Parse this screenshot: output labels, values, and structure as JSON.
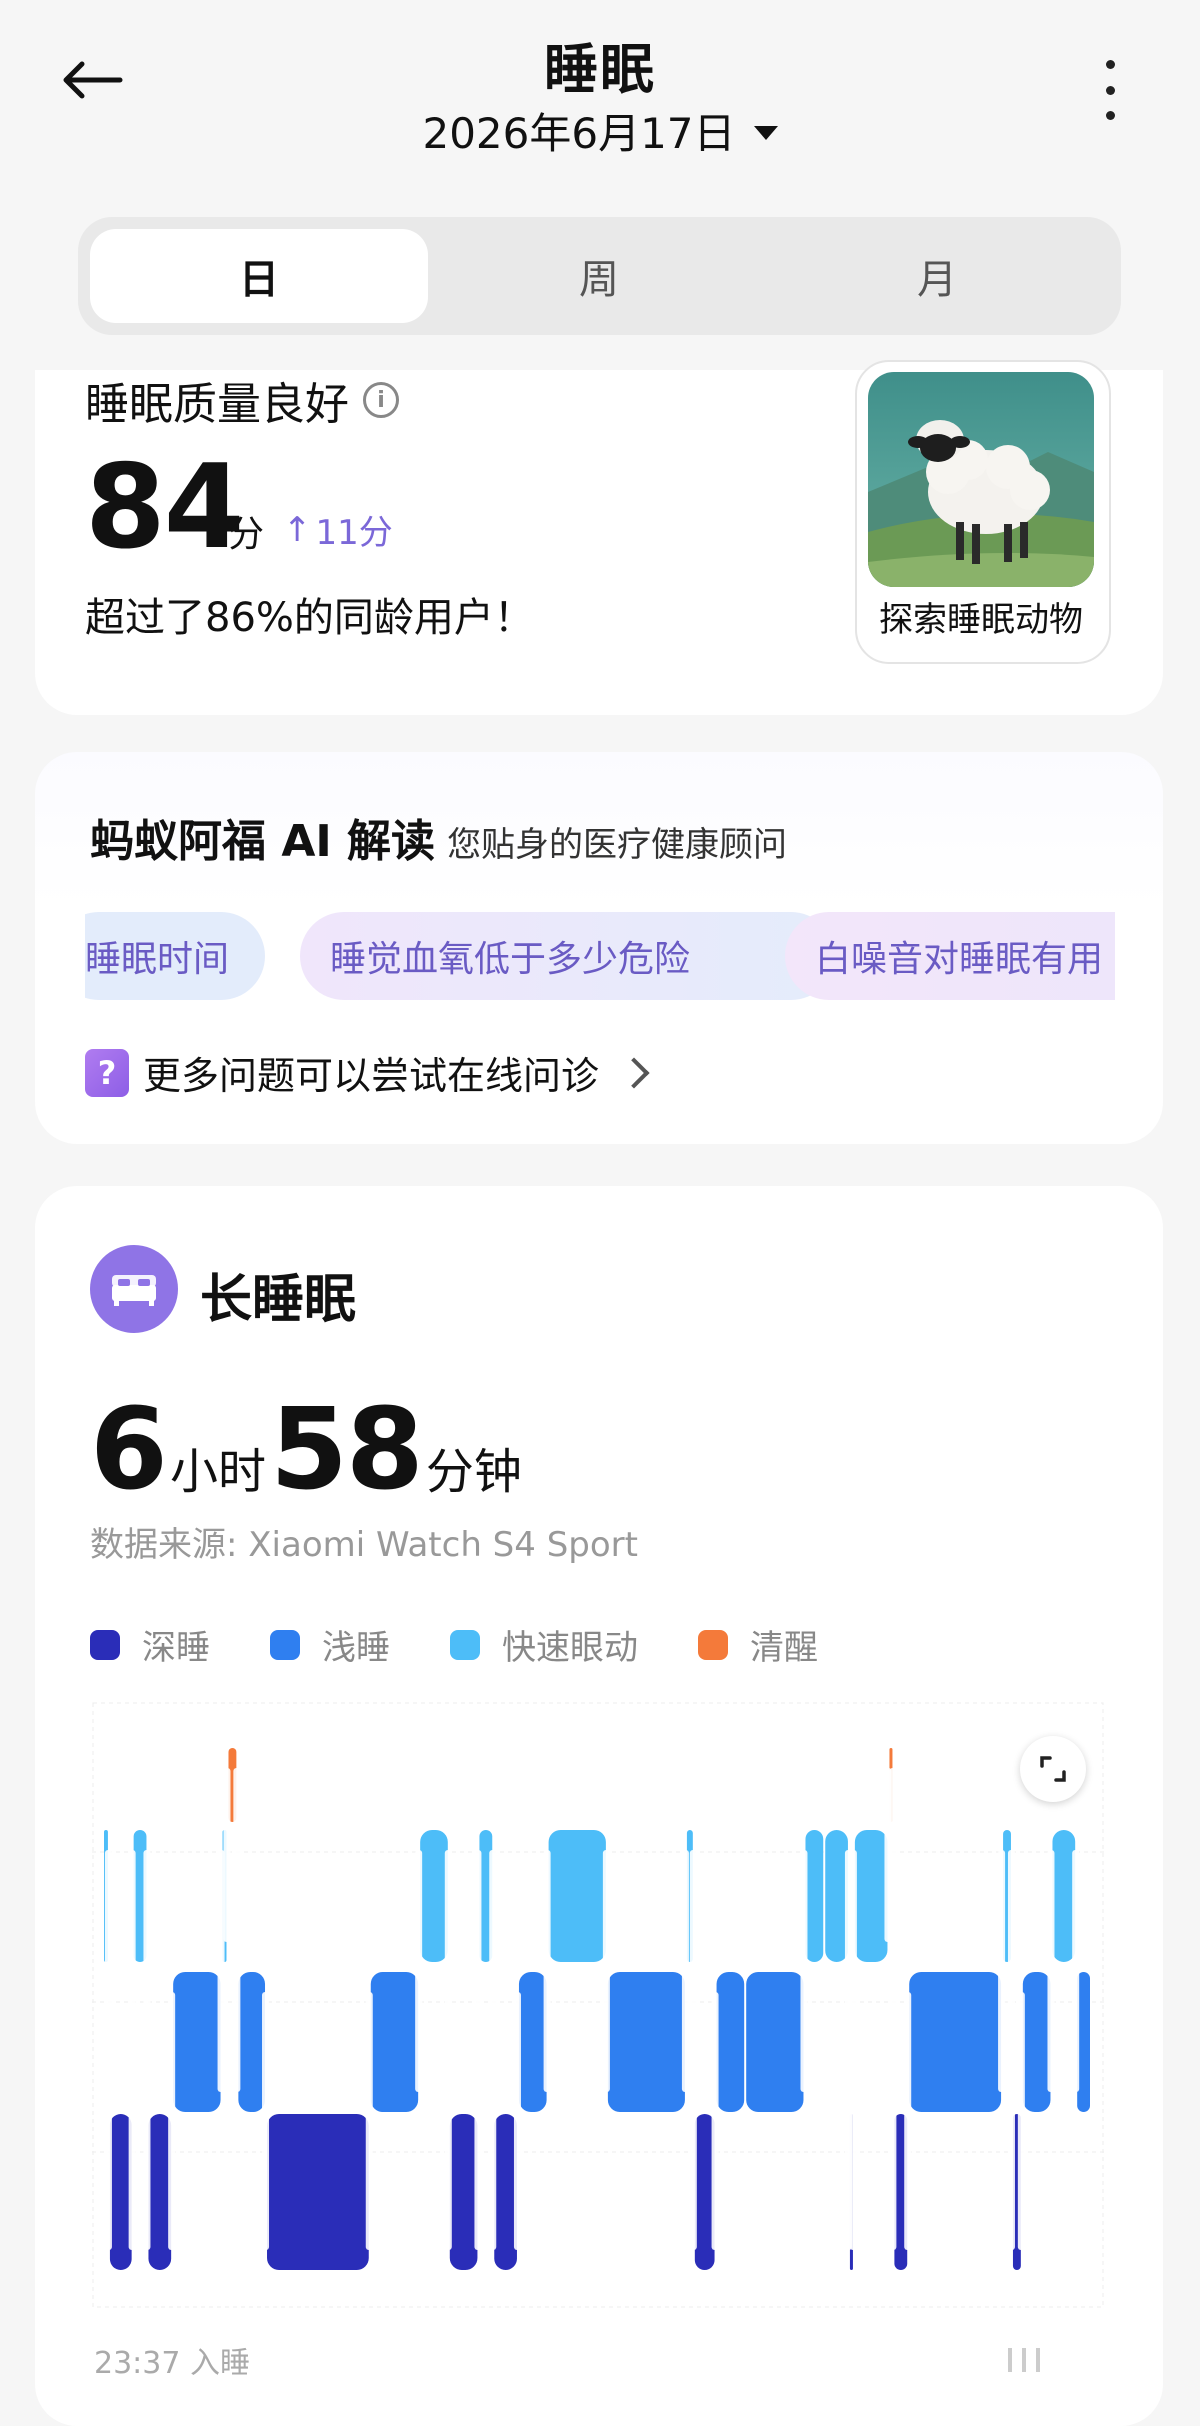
{
  "header": {
    "title": "睡眠",
    "date": "2026年6月17日"
  },
  "tabs": [
    {
      "label": "日",
      "active": true
    },
    {
      "label": "周",
      "active": false
    },
    {
      "label": "月",
      "active": false
    }
  ],
  "quality": {
    "title": "睡眠质量良好",
    "score": "84",
    "score_unit": "分",
    "delta": "11分",
    "beat_text": "超过了86%的同龄用户！",
    "animal_label": "探索睡眠动物"
  },
  "ai": {
    "title": "蚂蚁阿福 AI 解读",
    "subtitle": "您贴身的医疗健康顾问",
    "chips": [
      "睡眠时间",
      "睡觉血氧低于多少危险",
      "白噪音对睡眠有用"
    ],
    "more_questions": "更多问题可以尝试在线问诊"
  },
  "long_sleep": {
    "title": "长睡眠",
    "hours": "6",
    "hours_unit": "小时",
    "minutes": "58",
    "minutes_unit": "分钟",
    "source": "数据来源: Xiaomi Watch S4 Sport"
  },
  "legend": [
    {
      "label": "深睡",
      "color": "#2a2db8"
    },
    {
      "label": "浅睡",
      "color": "#2f7ff0"
    },
    {
      "label": "快速眼动",
      "color": "#4dbdf8"
    },
    {
      "label": "清醒",
      "color": "#f47a3a"
    }
  ],
  "chart_footer": {
    "start_time": "23:37 入睡"
  },
  "chart_data": {
    "type": "bar",
    "levels": [
      "清醒",
      "快速眼动",
      "浅睡",
      "深睡"
    ],
    "segments": [
      {
        "start": 0.0,
        "end": 0.6,
        "stage": 1
      },
      {
        "start": 0.6,
        "end": 3.0,
        "stage": 3
      },
      {
        "start": 3.0,
        "end": 4.5,
        "stage": 1
      },
      {
        "start": 4.5,
        "end": 7.0,
        "stage": 3
      },
      {
        "start": 7.0,
        "end": 12.0,
        "stage": 2
      },
      {
        "start": 12.0,
        "end": 12.6,
        "stage": 1
      },
      {
        "start": 12.6,
        "end": 13.6,
        "stage": 0
      },
      {
        "start": 13.6,
        "end": 16.5,
        "stage": 2
      },
      {
        "start": 16.5,
        "end": 27.0,
        "stage": 3
      },
      {
        "start": 27.0,
        "end": 32.0,
        "stage": 2
      },
      {
        "start": 32.0,
        "end": 35.0,
        "stage": 1
      },
      {
        "start": 35.0,
        "end": 38.0,
        "stage": 3
      },
      {
        "start": 38.0,
        "end": 39.5,
        "stage": 1
      },
      {
        "start": 39.5,
        "end": 42.0,
        "stage": 3
      },
      {
        "start": 42.0,
        "end": 45.0,
        "stage": 2
      },
      {
        "start": 45.0,
        "end": 51.0,
        "stage": 1
      },
      {
        "start": 51.0,
        "end": 59.0,
        "stage": 2
      },
      {
        "start": 59.0,
        "end": 59.8,
        "stage": 1
      },
      {
        "start": 59.8,
        "end": 62.0,
        "stage": 3
      },
      {
        "start": 62.0,
        "end": 65.0,
        "stage": 2
      },
      {
        "start": 65.0,
        "end": 71.0,
        "stage": 2
      },
      {
        "start": 71.0,
        "end": 73.0,
        "stage": 1
      },
      {
        "start": 73.0,
        "end": 75.5,
        "stage": 1
      },
      {
        "start": 75.5,
        "end": 76.0,
        "stage": 3
      },
      {
        "start": 76.0,
        "end": 79.5,
        "stage": 1
      },
      {
        "start": 79.5,
        "end": 80.0,
        "stage": 0
      },
      {
        "start": 80.0,
        "end": 81.5,
        "stage": 3
      },
      {
        "start": 81.5,
        "end": 91.0,
        "stage": 2
      },
      {
        "start": 91.0,
        "end": 92.0,
        "stage": 1
      },
      {
        "start": 92.0,
        "end": 93.0,
        "stage": 3
      },
      {
        "start": 93.0,
        "end": 96.0,
        "stage": 2
      },
      {
        "start": 96.0,
        "end": 98.5,
        "stage": 1
      },
      {
        "start": 98.5,
        "end": 100.0,
        "stage": 2
      }
    ]
  }
}
